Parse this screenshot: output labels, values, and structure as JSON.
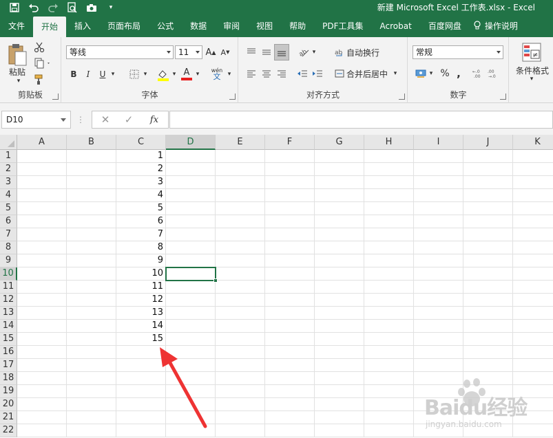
{
  "window": {
    "title": "新建 Microsoft Excel 工作表.xlsx  -  Excel"
  },
  "tabs": [
    "文件",
    "开始",
    "插入",
    "页面布局",
    "公式",
    "数据",
    "审阅",
    "视图",
    "帮助",
    "PDF工具集",
    "Acrobat",
    "百度网盘",
    "操作说明"
  ],
  "active_tab": "开始",
  "ribbon": {
    "clipboard": {
      "label": "剪贴板",
      "paste": "粘贴"
    },
    "font": {
      "label": "字体",
      "font_name": "等线",
      "font_size": "11",
      "bold": "B",
      "italic": "I",
      "underline": "U",
      "grow": "A",
      "shrink": "A",
      "font_color": "A",
      "phonetic": "wén"
    },
    "alignment": {
      "label": "对齐方式",
      "wrap_text": "自动换行",
      "merge_center": "合并后居中"
    },
    "number": {
      "label": "数字",
      "format": "常规",
      "percent": "%",
      "comma": ","
    },
    "styles": {
      "conditional_format": "条件格式"
    }
  },
  "formula_bar": {
    "name_box": "D10",
    "fx": "fx",
    "content": ""
  },
  "sheet": {
    "columns": [
      "A",
      "B",
      "C",
      "D",
      "E",
      "F",
      "G",
      "H",
      "I",
      "J",
      "K"
    ],
    "selected_column": "D",
    "rows": [
      "1",
      "2",
      "3",
      "4",
      "5",
      "6",
      "7",
      "8",
      "9",
      "10",
      "11",
      "12",
      "13",
      "14",
      "15",
      "16",
      "17",
      "18",
      "19",
      "20",
      "21",
      "22"
    ],
    "selected_row": "10",
    "column_c_values": [
      "1",
      "2",
      "3",
      "4",
      "5",
      "6",
      "7",
      "8",
      "9",
      "10",
      "11",
      "12",
      "13",
      "14",
      "15"
    ],
    "active_cell": "D10"
  },
  "watermark": {
    "brand": "Baidu经验",
    "url": "jingyan.baidu.com"
  },
  "colors": {
    "excel_green": "#217346",
    "annotation_red": "#ee3333"
  }
}
